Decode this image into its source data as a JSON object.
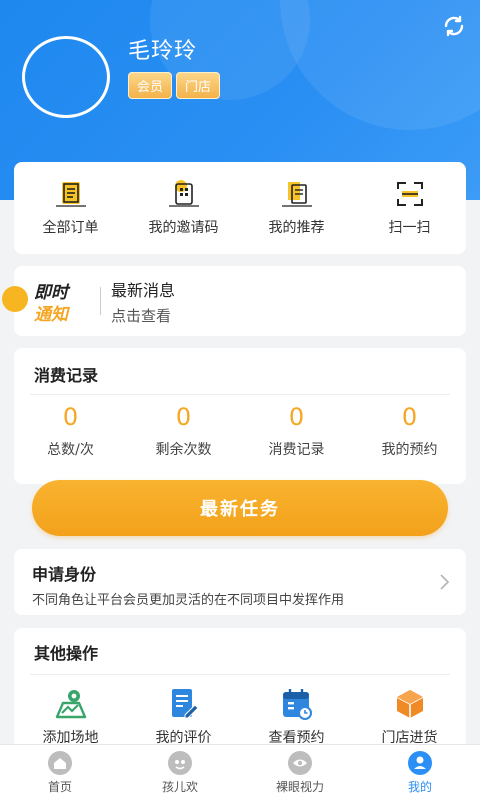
{
  "profile": {
    "name": "毛玲玲",
    "badges": [
      "会员",
      "门店"
    ]
  },
  "quick_actions": [
    {
      "label": "全部订单",
      "icon": "orders-icon"
    },
    {
      "label": "我的邀请码",
      "icon": "invite-code-icon"
    },
    {
      "label": "我的推荐",
      "icon": "recommend-icon"
    },
    {
      "label": "扫一扫",
      "icon": "scan-icon"
    }
  ],
  "notice": {
    "logo_line1": "即时",
    "logo_line2": "通知",
    "title": "最新消息",
    "subtitle": "点击查看"
  },
  "records": {
    "title": "消费记录",
    "stats": [
      {
        "value": "0",
        "label": "总数/次"
      },
      {
        "value": "0",
        "label": "剩余次数"
      },
      {
        "value": "0",
        "label": "消费记录"
      },
      {
        "value": "0",
        "label": "我的预约"
      }
    ]
  },
  "task_button": "最新任务",
  "identity": {
    "title": "申请身份",
    "subtitle": "不同角色让平台会员更加灵活的在不同项目中发挥作用"
  },
  "others": {
    "title": "其他操作",
    "items": [
      {
        "label": "添加场地",
        "icon": "map-pin-icon"
      },
      {
        "label": "我的评价",
        "icon": "edit-doc-icon"
      },
      {
        "label": "查看预约",
        "icon": "calendar-icon"
      },
      {
        "label": "门店进货",
        "icon": "box-icon"
      }
    ]
  },
  "tabs": [
    {
      "label": "首页",
      "icon": "home-icon",
      "active": false
    },
    {
      "label": "孩儿欢",
      "icon": "kids-icon",
      "active": false
    },
    {
      "label": "裸眼视力",
      "icon": "eye-icon",
      "active": false
    },
    {
      "label": "我的",
      "icon": "user-icon",
      "active": true
    }
  ],
  "colors": {
    "primary": "#2b8ff5",
    "accent": "#f5a623"
  }
}
